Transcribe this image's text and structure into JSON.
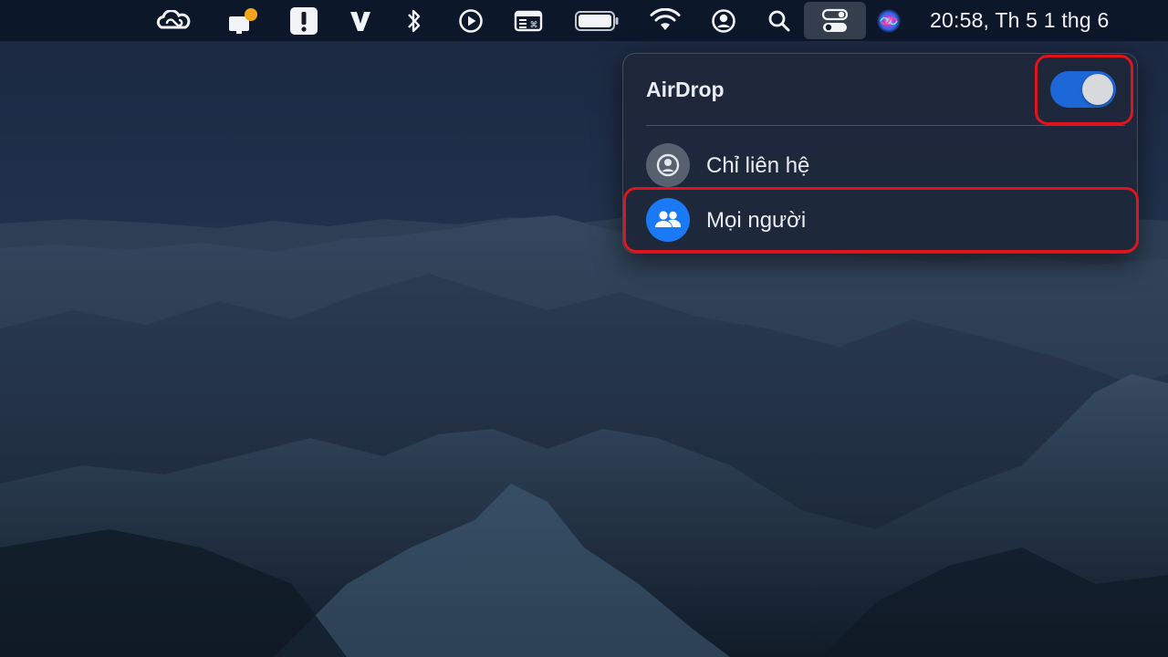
{
  "menubar": {
    "clock": "20:58, Th 5 1 thg 6",
    "icons": [
      "creative-cloud-icon",
      "notification-app-icon",
      "alert-icon",
      "v-app-icon",
      "bluetooth-icon",
      "play-icon",
      "keyboard-viewer-icon",
      "battery-icon",
      "wifi-icon",
      "user-account-icon",
      "search-icon",
      "control-center-icon",
      "siri-icon"
    ]
  },
  "airdrop_panel": {
    "title": "AirDrop",
    "enabled": true,
    "options": [
      {
        "label": "Chỉ liên hệ",
        "icon": "contacts-icon",
        "selected": false
      },
      {
        "label": "Mọi người",
        "icon": "everyone-icon",
        "selected": true
      }
    ]
  },
  "colors": {
    "accent": "#1a7af5",
    "switch_on": "#1d68d8",
    "highlight": "#e0141c"
  }
}
